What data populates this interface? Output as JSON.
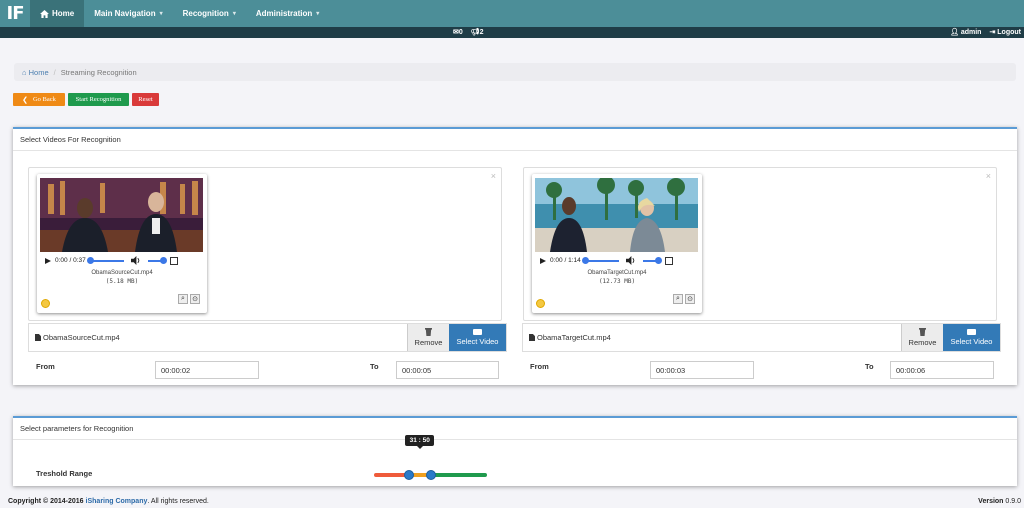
{
  "nav": {
    "brand": "IF",
    "items": [
      {
        "label": "Home",
        "active": true
      },
      {
        "label": "Main Navigation"
      },
      {
        "label": "Recognition"
      },
      {
        "label": "Administration"
      }
    ]
  },
  "status": {
    "mail_count": "0",
    "alert_count": "2",
    "user": "admin",
    "logout": "Logout"
  },
  "breadcrumb": {
    "home": "Home",
    "current": "Streaming Recognition"
  },
  "actions": {
    "back": "Go Back",
    "start": "Start Recognition",
    "reset": "Reset"
  },
  "videos_panel": {
    "title": "Select Videos For Recognition",
    "source": {
      "preview_name": "ObamaSourceCut.mp4",
      "preview_size": "(5.18 MB)",
      "player_time": "0:00 / 0:37",
      "file_name": "ObamaSourceCut.mp4",
      "remove": "Remove",
      "select": "Select Video",
      "from_label": "From",
      "from_value": "00:00:02",
      "to_label": "To",
      "to_value": "00:00:05"
    },
    "target": {
      "preview_name": "ObamaTargetCut.mp4",
      "preview_size": "(12.73 MB)",
      "player_time": "0:00 / 1:14",
      "file_name": "ObamaTargetCut.mp4",
      "remove": "Remove",
      "select": "Select Video",
      "from_label": "From",
      "from_value": "00:00:03",
      "to_label": "To",
      "to_value": "00:00:06"
    }
  },
  "params_panel": {
    "title": "Select parameters for Recognition",
    "threshold_label": "Treshold Range",
    "range_text": "31 : 50",
    "range_low": 31,
    "range_high": 50
  },
  "footer": {
    "copyright_prefix": "Copyright © 2014-2016 ",
    "company": "iSharing Company",
    "copyright_suffix": ". All rights reserved.",
    "version_label": "Version",
    "version_value": "0.9.0"
  },
  "colors": {
    "navbar": "#4c8e98",
    "statusbar": "#1f3d47",
    "go_back": "#ef8a16",
    "start": "#1f9a4d",
    "reset": "#d93a3a",
    "select_video": "#337ab7"
  },
  "icons": [
    "home-icon",
    "mail-icon",
    "bullhorn-icon",
    "user-icon",
    "logout-icon",
    "play-icon",
    "volume-icon",
    "fullscreen-icon",
    "file-icon",
    "trash-icon",
    "folder-open-icon",
    "zoom-icon",
    "rotate-icon",
    "close-icon",
    "chevron-left-icon"
  ]
}
